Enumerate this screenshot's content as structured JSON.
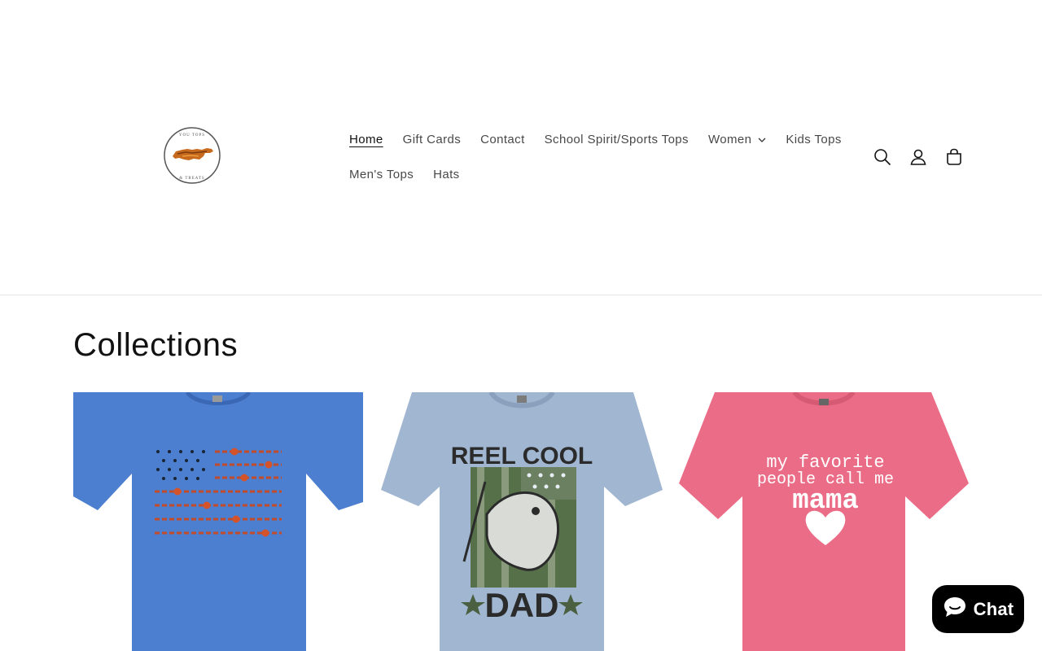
{
  "header": {
    "logo": {
      "alt": "UP Tops & Treats",
      "ring_text_top": "YOU TOPS",
      "ring_text_bottom": "& TREATS"
    },
    "nav": [
      {
        "label": "Home",
        "active": true
      },
      {
        "label": "Gift Cards"
      },
      {
        "label": "Contact"
      },
      {
        "label": "School Spirit/Sports Tops"
      },
      {
        "label": "Women",
        "has_dropdown": true
      },
      {
        "label": "Kids Tops"
      },
      {
        "label": "Men's Tops"
      },
      {
        "label": "Hats"
      }
    ],
    "icons": [
      "search-icon",
      "account-icon",
      "cart-icon"
    ]
  },
  "main": {
    "title": "Collections",
    "collections": [
      {
        "image": "blue-tshirt-floral-american-flag",
        "shirt_color": "#4d7fd0"
      },
      {
        "image": "light-blue-tshirt-reel-cool-dad",
        "shirt_color": "#a1b6d1",
        "graphic_text_top": "REEL COOL",
        "graphic_text_bottom": "DAD"
      },
      {
        "image": "pink-tshirt-my-favorite-people-call-me-mama",
        "shirt_color": "#ea6c86",
        "graphic_text_line1": "my favorite",
        "graphic_text_line2": "people call me",
        "graphic_text_line3": "mama"
      }
    ]
  },
  "chat": {
    "label": "Chat"
  },
  "colors": {
    "text": "#121212",
    "divider": "#e6e6e6",
    "chat_background": "#000000"
  }
}
